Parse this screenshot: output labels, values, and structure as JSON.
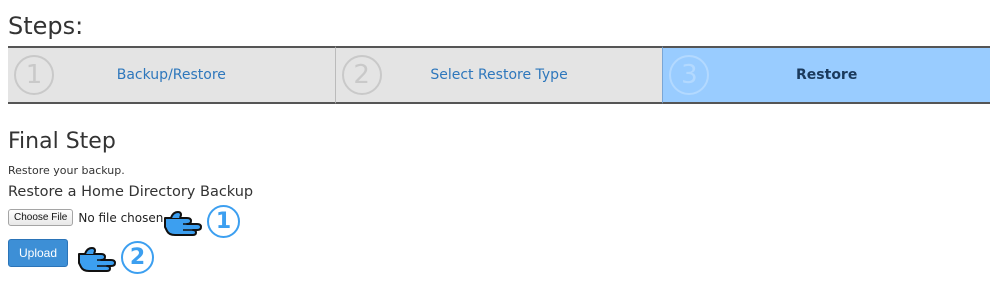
{
  "steps": {
    "heading": "Steps:",
    "items": [
      {
        "number": "1",
        "label": "Backup/Restore"
      },
      {
        "number": "2",
        "label": "Select Restore Type"
      },
      {
        "number": "3",
        "label": "Restore"
      }
    ],
    "active_index": 2
  },
  "final": {
    "title": "Final Step",
    "description": "Restore your backup.",
    "backup_title": "Restore a Home Directory Backup",
    "choose_file_label": "Choose File",
    "file_status": "No file chosen",
    "upload_label": "Upload"
  },
  "annotations": [
    {
      "number": "1",
      "icon": "pointing-hand-icon"
    },
    {
      "number": "2",
      "icon": "pointing-hand-icon"
    }
  ],
  "colors": {
    "active_step": "#99ccff",
    "inactive_step": "#e4e4e4",
    "link": "#2e77bc",
    "upload_button": "#3d8fd6",
    "annotation": "#3c9ff0"
  }
}
